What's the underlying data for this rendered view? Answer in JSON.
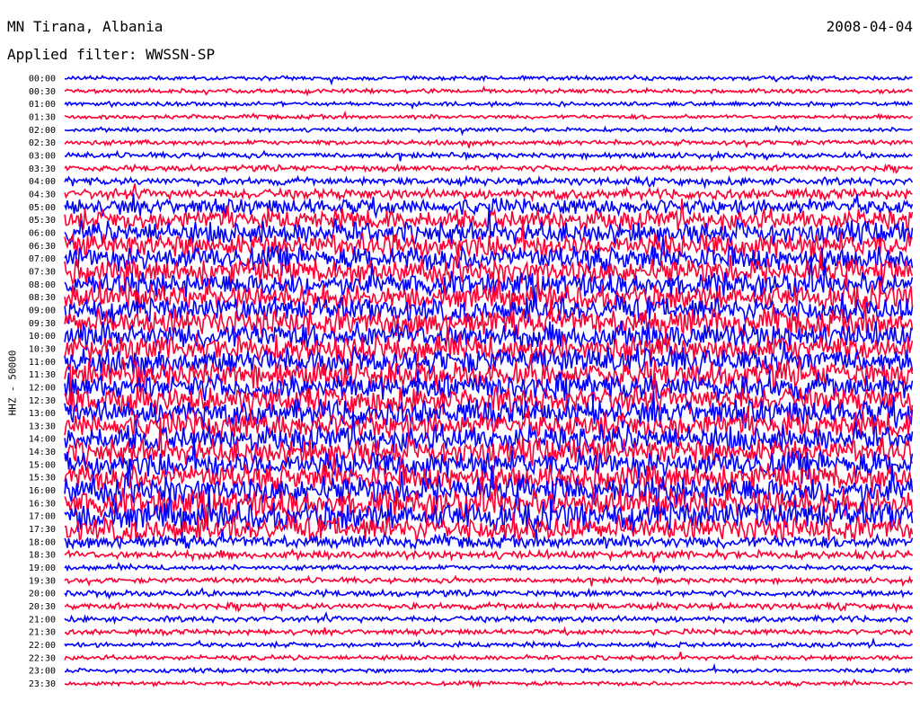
{
  "header": {
    "station": "MN Tirana, Albania",
    "date": "2008-04-04",
    "filter": "Applied filter: WWSSN-SP"
  },
  "chart_data": {
    "type": "line",
    "title": "MN Tirana, Albania",
    "ylabel": "HHZ - 50000",
    "row_labels": [
      "00:00",
      "00:30",
      "01:00",
      "01:30",
      "02:00",
      "02:30",
      "03:00",
      "03:30",
      "04:00",
      "04:30",
      "05:00",
      "05:30",
      "06:00",
      "06:30",
      "07:00",
      "07:30",
      "08:00",
      "08:30",
      "09:00",
      "09:30",
      "10:00",
      "10:30",
      "11:00",
      "11:30",
      "12:00",
      "12:30",
      "13:00",
      "13:30",
      "14:00",
      "14:30",
      "15:00",
      "15:30",
      "16:00",
      "16:30",
      "17:00",
      "17:30",
      "18:00",
      "18:30",
      "19:00",
      "19:30",
      "20:00",
      "20:30",
      "21:00",
      "21:30",
      "22:00",
      "22:30",
      "23:00",
      "23:30"
    ],
    "relative_amplitude": [
      1,
      1,
      1,
      1,
      1,
      1.2,
      1.3,
      1.4,
      1.8,
      2.5,
      4,
      5,
      5.5,
      6,
      6,
      6,
      6,
      6,
      6,
      6.5,
      6.5,
      6.5,
      6.5,
      6.5,
      6.5,
      6.5,
      6.5,
      6.5,
      6.5,
      6.5,
      6.5,
      6.5,
      7,
      7,
      7,
      6,
      3,
      2,
      1.2,
      1.3,
      1.5,
      1.5,
      1.4,
      1.3,
      1.2,
      1.1,
      1,
      1
    ],
    "series_colors": [
      "#0000ff",
      "#ff0033"
    ],
    "grid": false
  }
}
